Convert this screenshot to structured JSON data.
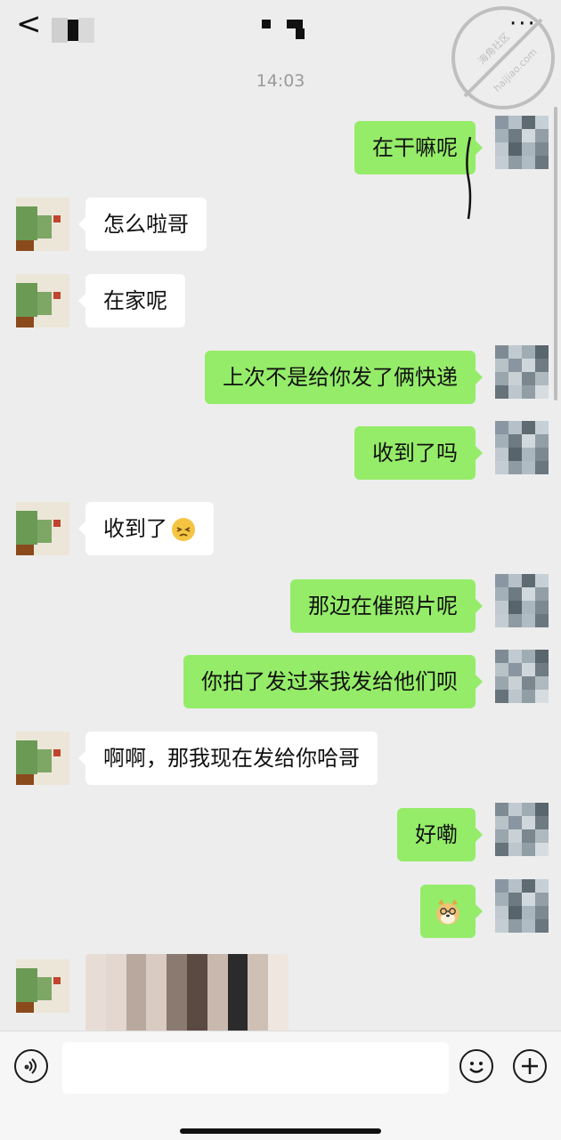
{
  "header": {
    "back_icon": "chevron-left-icon",
    "more_label": "···",
    "time": "14:03"
  },
  "watermark": {
    "text_cn": "海角社区",
    "text_en": "haijiao.com"
  },
  "messages": [
    {
      "side": "right",
      "text": "在干嘛呢"
    },
    {
      "side": "left",
      "text": "怎么啦哥"
    },
    {
      "side": "left",
      "text": "在家呢"
    },
    {
      "side": "right",
      "text": "上次不是给你发了俩快递"
    },
    {
      "side": "right",
      "text": "收到了吗"
    },
    {
      "side": "left",
      "text": "收到了",
      "emoji": "sleepy-face-emoji"
    },
    {
      "side": "right",
      "text": "那边在催照片呢"
    },
    {
      "side": "right",
      "text": "你拍了发过来我发给他们呗"
    },
    {
      "side": "left",
      "text": "啊啊，那我现在发给你哈哥"
    },
    {
      "side": "right",
      "text": "好嘞"
    },
    {
      "side": "right",
      "sticker": "doge-sticker"
    },
    {
      "side": "left",
      "image": "blurred-photo"
    }
  ],
  "input_bar": {
    "voice_icon": "voice-icon",
    "emoji_icon": "emoji-icon",
    "plus_icon": "plus-icon",
    "placeholder": ""
  },
  "colors": {
    "background": "#ededed",
    "bubble_self": "#95ec69",
    "bubble_other": "#ffffff"
  }
}
